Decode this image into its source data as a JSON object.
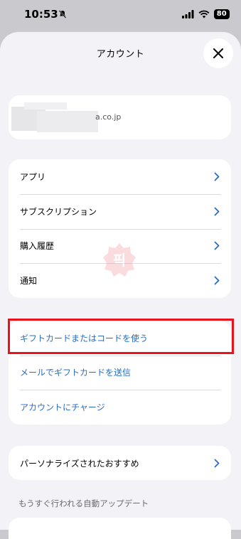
{
  "status": {
    "time": "10:53",
    "battery": "80"
  },
  "sheet": {
    "title": "アカウント"
  },
  "account": {
    "email_fragment": "a.co.jp"
  },
  "menu": {
    "items": [
      {
        "label": "アプリ"
      },
      {
        "label": "サブスクリプション"
      },
      {
        "label": "購入履歴"
      },
      {
        "label": "通知"
      }
    ]
  },
  "gift": {
    "items": [
      {
        "label": "ギフトカードまたはコードを使う"
      },
      {
        "label": "メールでギフトカードを送信"
      },
      {
        "label": "アカウントにチャージ"
      }
    ]
  },
  "preferences": {
    "label": "パーソナライズされたおすすめ"
  },
  "footer": {
    "label": "もうすぐ行われる自動アップデート"
  },
  "watermark": {
    "glyph": "픽"
  },
  "colors": {
    "link": "#2b6cc4",
    "highlight": "#e8141c",
    "background": "#f2f2f7"
  }
}
